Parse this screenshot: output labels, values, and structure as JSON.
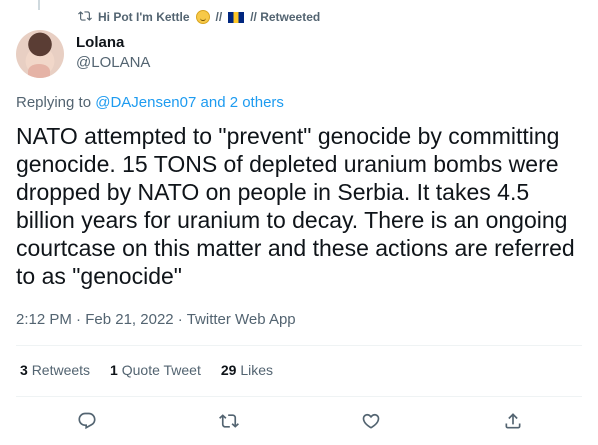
{
  "retweet_context": {
    "label": "Hi Pot I'm Kettle",
    "suffix_left": "//",
    "suffix_right": "// Retweeted"
  },
  "author": {
    "display_name": "Lolana",
    "handle": "@LOLANA"
  },
  "replying": {
    "prefix": "Replying to",
    "user": "@DAJensen07",
    "others": "and 2 others"
  },
  "tweet": {
    "text": "NATO attempted to \"prevent\" genocide by committing genocide. 15 TONS of depleted uranium bombs were dropped by NATO on people in Serbia. It takes 4.5 billion years for uranium to decay. There is an ongoing courtcase on this matter and these actions are referred to as \"genocide\""
  },
  "meta": {
    "time": "2:12 PM",
    "date": "Feb 21, 2022",
    "source": "Twitter Web App",
    "sep": "·"
  },
  "stats": {
    "retweets_count": "3",
    "retweets_label": "Retweets",
    "quotes_count": "1",
    "quotes_label": "Quote Tweet",
    "likes_count": "29",
    "likes_label": "Likes"
  },
  "icons": [
    "retweet-icon",
    "reply-icon",
    "like-icon",
    "share-icon"
  ],
  "colors": {
    "link": "#1d9bf0",
    "muted": "#536471",
    "text": "#0f1419"
  }
}
